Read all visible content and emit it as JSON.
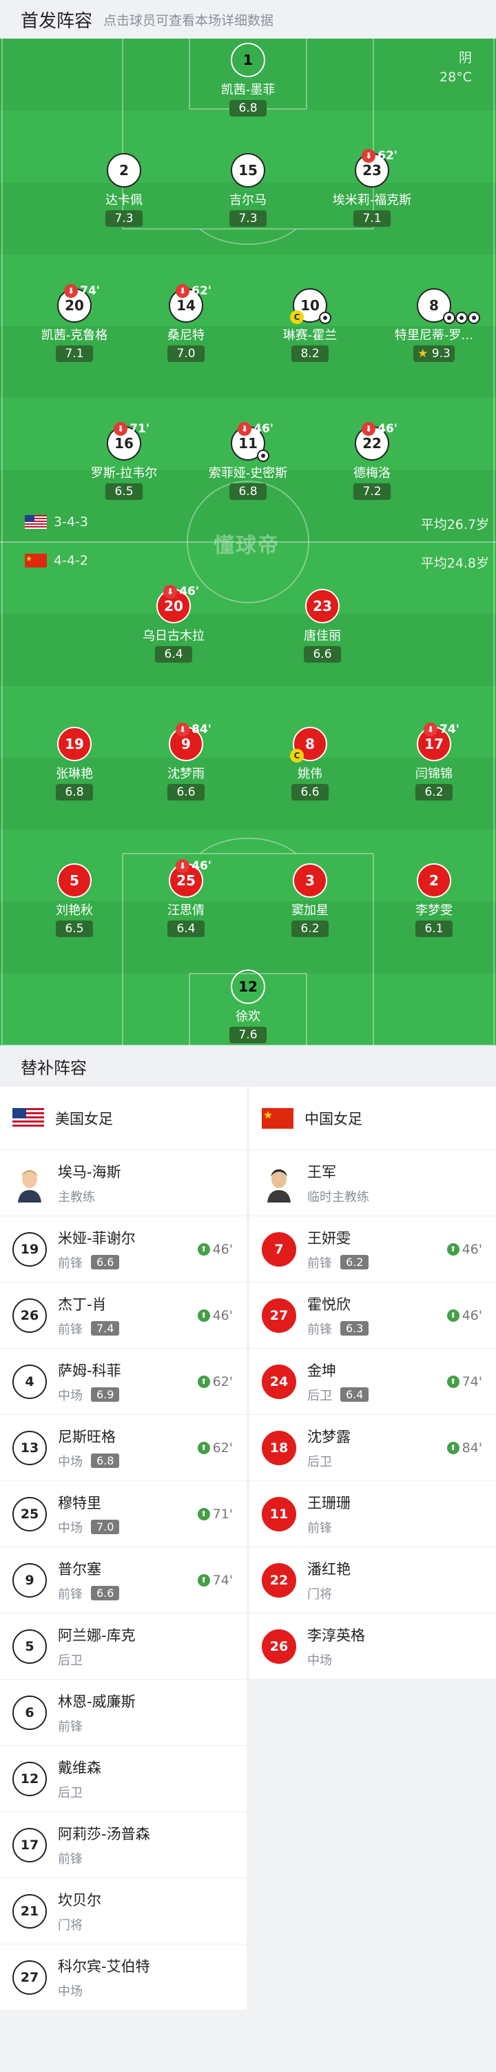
{
  "header": {
    "title": "首发阵容",
    "hint": "点击球员可查看本场详细数据"
  },
  "weather": {
    "condition": "阴",
    "temp": "28°C"
  },
  "watermark": "懂球帝",
  "colors": {
    "pitch_dark": "#36ac4a",
    "pitch_light": "#3cb650",
    "home": "#ffffff",
    "away": "#e21b1b",
    "gk": "#f5821f"
  },
  "home": {
    "formation": "3-4-3",
    "avg_age": "平均26.7岁",
    "players": [
      {
        "num": "1",
        "name": "凯茜-墨菲",
        "rating": "6.8",
        "gk": true
      },
      {
        "num": "2",
        "name": "达卡佩",
        "rating": "7.3"
      },
      {
        "num": "15",
        "name": "吉尔马",
        "rating": "7.3"
      },
      {
        "num": "23",
        "name": "埃米莉-福克斯",
        "rating": "7.1",
        "sub": "62'"
      },
      {
        "num": "20",
        "name": "凯茜-克鲁格",
        "rating": "7.1",
        "sub": "74'"
      },
      {
        "num": "14",
        "name": "桑尼特",
        "rating": "7.0",
        "sub": "62'"
      },
      {
        "num": "10",
        "name": "琳赛-霍兰",
        "rating": "8.2",
        "captain": "C",
        "goals": 1
      },
      {
        "num": "8",
        "name": "特里尼蒂-罗…",
        "rating": "9.3",
        "goals": 3,
        "mvp": true
      },
      {
        "num": "16",
        "name": "罗斯-拉韦尔",
        "rating": "6.5",
        "sub": "71'"
      },
      {
        "num": "11",
        "name": "索菲娅-史密斯",
        "rating": "6.8",
        "sub": "46'",
        "goals": 1
      },
      {
        "num": "22",
        "name": "德梅洛",
        "rating": "7.2",
        "sub": "46'"
      }
    ]
  },
  "away": {
    "formation": "4-4-2",
    "avg_age": "平均24.8岁",
    "players": [
      {
        "num": "20",
        "name": "乌日古木拉",
        "rating": "6.4",
        "sub": "46'"
      },
      {
        "num": "23",
        "name": "唐佳丽",
        "rating": "6.6"
      },
      {
        "num": "19",
        "name": "张琳艳",
        "rating": "6.8"
      },
      {
        "num": "9",
        "name": "沈梦雨",
        "rating": "6.6",
        "sub": "84'"
      },
      {
        "num": "8",
        "name": "姚伟",
        "rating": "6.6",
        "captain": "C"
      },
      {
        "num": "17",
        "name": "闫锦锦",
        "rating": "6.2",
        "sub": "74'"
      },
      {
        "num": "5",
        "name": "刘艳秋",
        "rating": "6.5"
      },
      {
        "num": "25",
        "name": "汪思倩",
        "rating": "6.4",
        "sub": "46'"
      },
      {
        "num": "3",
        "name": "窦加星",
        "rating": "6.2"
      },
      {
        "num": "2",
        "name": "李梦雯",
        "rating": "6.1"
      },
      {
        "num": "12",
        "name": "徐欢",
        "rating": "7.6",
        "gk": true
      }
    ]
  },
  "subs": {
    "title": "替补阵容",
    "home": {
      "team": "美国女足",
      "coach": {
        "name": "埃马-海斯",
        "role": "主教练"
      },
      "players": [
        {
          "num": "19",
          "name": "米娅-菲谢尔",
          "pos": "前锋",
          "rating": "6.6",
          "in": "46'"
        },
        {
          "num": "26",
          "name": "杰丁-肖",
          "pos": "前锋",
          "rating": "7.4",
          "in": "46'"
        },
        {
          "num": "4",
          "name": "萨姆-科菲",
          "pos": "中场",
          "rating": "6.9",
          "in": "62'"
        },
        {
          "num": "13",
          "name": "尼斯旺格",
          "pos": "中场",
          "rating": "6.8",
          "in": "62'"
        },
        {
          "num": "25",
          "name": "穆特里",
          "pos": "中场",
          "rating": "7.0",
          "in": "71'"
        },
        {
          "num": "9",
          "name": "普尔塞",
          "pos": "前锋",
          "rating": "6.6",
          "in": "74'"
        },
        {
          "num": "5",
          "name": "阿兰娜-库克",
          "pos": "后卫"
        },
        {
          "num": "6",
          "name": "林恩-威廉斯",
          "pos": "前锋"
        },
        {
          "num": "12",
          "name": "戴维森",
          "pos": "后卫"
        },
        {
          "num": "17",
          "name": "阿莉莎-汤普森",
          "pos": "前锋"
        },
        {
          "num": "21",
          "name": "坎贝尔",
          "pos": "门将"
        },
        {
          "num": "27",
          "name": "科尔宾-艾伯特",
          "pos": "中场"
        }
      ]
    },
    "away": {
      "team": "中国女足",
      "coach": {
        "name": "王军",
        "role": "临时主教练"
      },
      "players": [
        {
          "num": "7",
          "name": "王妍雯",
          "pos": "前锋",
          "rating": "6.2",
          "in": "46'"
        },
        {
          "num": "27",
          "name": "霍悦欣",
          "pos": "前锋",
          "rating": "6.3",
          "in": "46'"
        },
        {
          "num": "24",
          "name": "金坤",
          "pos": "后卫",
          "rating": "6.4",
          "in": "74'"
        },
        {
          "num": "18",
          "name": "沈梦露",
          "pos": "后卫",
          "in": "84'"
        },
        {
          "num": "11",
          "name": "王珊珊",
          "pos": "前锋"
        },
        {
          "num": "22",
          "name": "潘红艳",
          "pos": "门将"
        },
        {
          "num": "26",
          "name": "李淳英格",
          "pos": "中场"
        }
      ]
    }
  }
}
